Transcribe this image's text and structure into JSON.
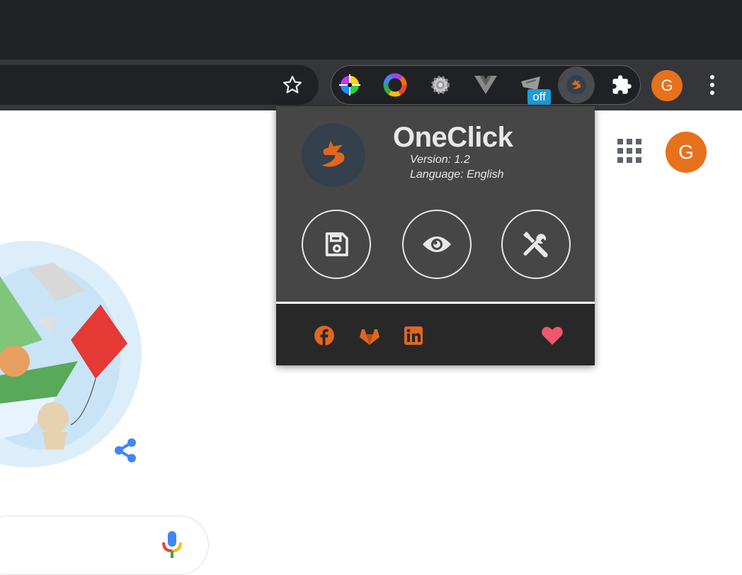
{
  "browser": {
    "extensions": [
      "color-picker-icon",
      "color-wheel-icon",
      "gear-icon",
      "vue-devtools-icon",
      "capture-icon",
      "oneclick-dragon-icon",
      "puzzle-icon"
    ],
    "badge_text": "off",
    "profile_initial": "G"
  },
  "page": {
    "profile_initial": "G"
  },
  "popup": {
    "title": "OneClick",
    "version": "Version: 1.2",
    "language": "Language: English",
    "actions": [
      "save-icon",
      "eye-icon",
      "tools-icon"
    ],
    "footer_links": [
      "facebook-icon",
      "gitlab-icon",
      "linkedin-icon"
    ],
    "heart": "heart-icon"
  },
  "colors": {
    "accent": "#e0671f",
    "heart": "#f0566d",
    "avatar": "#e8711c",
    "popup_bg": "#464646",
    "footer_bg": "#282828"
  }
}
